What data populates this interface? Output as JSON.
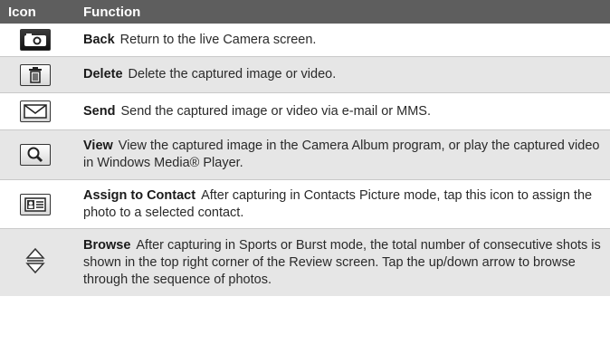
{
  "header": {
    "col_icon": "Icon",
    "col_function": "Function"
  },
  "rows": [
    {
      "icon": "camera-icon",
      "name": "Back",
      "desc": "Return to the live Camera screen."
    },
    {
      "icon": "trash-icon",
      "name": "Delete",
      "desc": "Delete the captured image or video."
    },
    {
      "icon": "envelope-icon",
      "name": "Send",
      "desc": "Send the captured image or video via e-mail or MMS."
    },
    {
      "icon": "magnifier-icon",
      "name": "View",
      "desc": "View the captured image in the Camera Album program, or play the captured video in Windows Media® Player."
    },
    {
      "icon": "contact-card-icon",
      "name": "Assign to Contact",
      "desc": "After capturing in Contacts Picture mode, tap this icon to assign the photo to a selected contact."
    },
    {
      "icon": "up-down-arrow-icon",
      "name": "Browse",
      "desc": "After capturing in Sports or Burst mode, the total number of consecutive shots is shown in the top right corner of the Review screen. Tap the up/down arrow to browse through the sequence of photos."
    }
  ]
}
